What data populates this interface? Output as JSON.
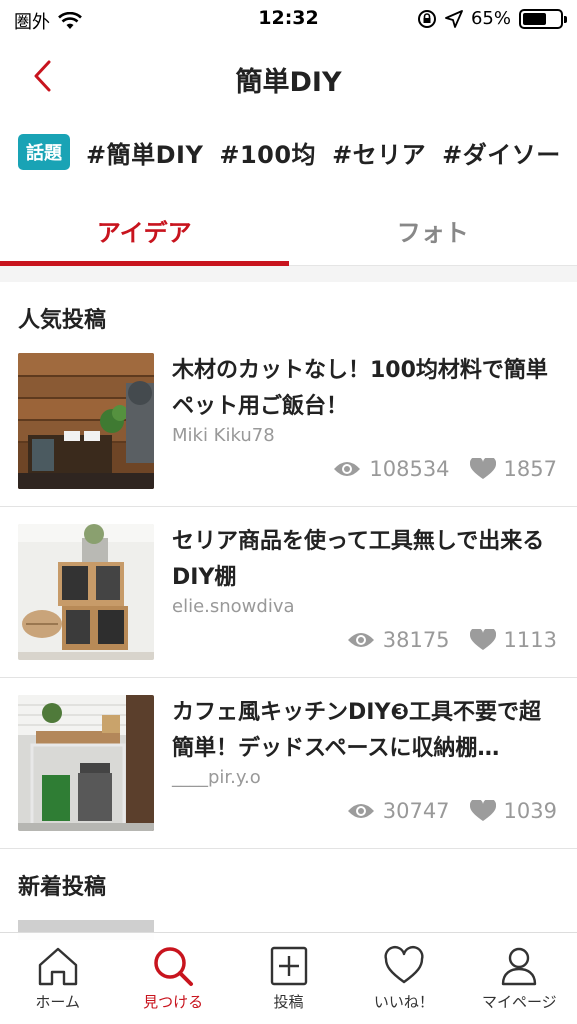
{
  "status_bar": {
    "carrier": "圏外",
    "time": "12:32",
    "battery": "65%",
    "battery_level": 0.65
  },
  "header": {
    "title": "簡単DIY",
    "back_icon": "chevron-left-icon"
  },
  "tags": {
    "badge": "話題",
    "items": [
      "#簡単DIY",
      "#100均",
      "#セリア",
      "#ダイソー",
      "#"
    ]
  },
  "tabs": [
    {
      "label": "アイデア",
      "active": true
    },
    {
      "label": "フォト",
      "active": false
    }
  ],
  "sections": {
    "popular": "人気投稿",
    "new": "新着投稿"
  },
  "posts": [
    {
      "title": "木材のカットなし！100均材料で簡単ペット用ご飯台！",
      "author": "Miki Kiku78",
      "views": "108534",
      "likes": "1857"
    },
    {
      "title": "セリア商品を使って工具無しで出来るDIY棚",
      "author": "elie.snowdiva",
      "views": "38175",
      "likes": "1113"
    },
    {
      "title": "カフェ風キッチンDIY❸工具不要で超簡単！デッドスペースに収納棚…",
      "author": "____pir.y.o",
      "views": "30747",
      "likes": "1039"
    }
  ],
  "bottom_nav": [
    {
      "label": "ホーム",
      "icon": "home-icon",
      "active": false
    },
    {
      "label": "見つける",
      "icon": "search-icon",
      "active": true
    },
    {
      "label": "投稿",
      "icon": "plus-square-icon",
      "active": false
    },
    {
      "label": "いいね！",
      "icon": "heart-icon",
      "active": false
    },
    {
      "label": "マイページ",
      "icon": "person-icon",
      "active": false
    }
  ],
  "colors": {
    "accent": "#c8141e",
    "badge": "#19a3b5",
    "muted": "#999999"
  }
}
